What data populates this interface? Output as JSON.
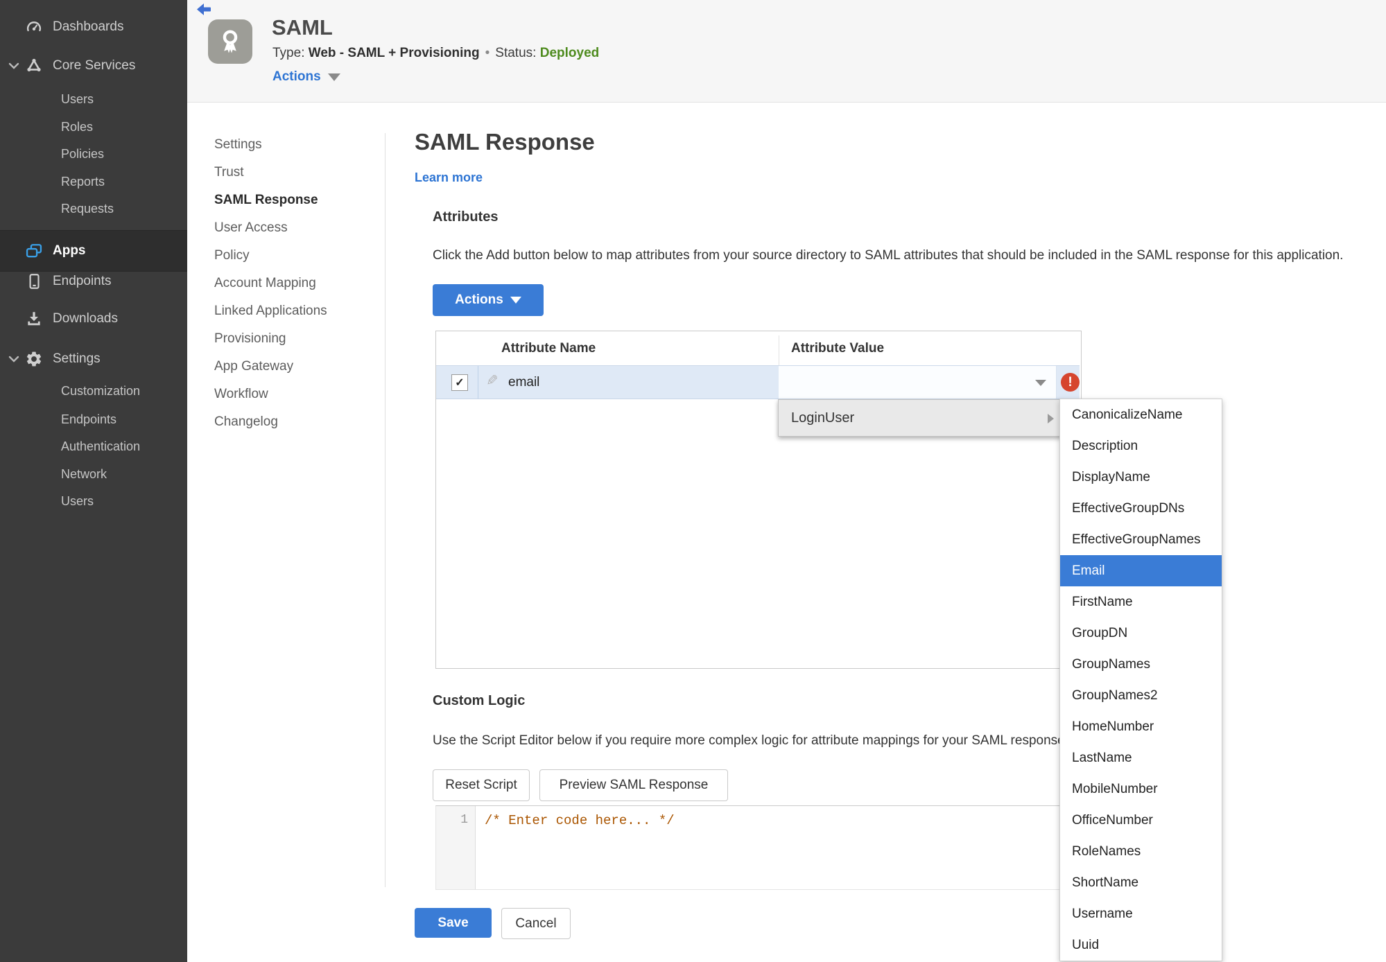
{
  "sidebar": {
    "items": [
      {
        "label": "Dashboards"
      },
      {
        "label": "Core Services"
      },
      {
        "label": "Apps"
      },
      {
        "label": "Endpoints"
      },
      {
        "label": "Downloads"
      },
      {
        "label": "Settings"
      }
    ],
    "core_services_children": [
      "Users",
      "Roles",
      "Policies",
      "Reports",
      "Requests"
    ],
    "settings_children": [
      "Customization",
      "Endpoints",
      "Authentication",
      "Network",
      "Users"
    ]
  },
  "header": {
    "title": "SAML",
    "type_label": "Type:",
    "type_value": "Web - SAML + Provisioning",
    "separator": "•",
    "status_label": "Status:",
    "status_value": "Deployed",
    "actions_label": "Actions"
  },
  "subnav": {
    "items": [
      "Settings",
      "Trust",
      "SAML Response",
      "User Access",
      "Policy",
      "Account Mapping",
      "Linked Applications",
      "Provisioning",
      "App Gateway",
      "Workflow",
      "Changelog"
    ],
    "active": "SAML Response"
  },
  "main": {
    "page_title": "SAML Response",
    "learn_more": "Learn more",
    "attributes": {
      "heading": "Attributes",
      "description": "Click the Add button below to map attributes from your source directory to SAML attributes that should be included in the SAML response for this application.",
      "actions_button": "Actions"
    },
    "table": {
      "columns": [
        "Attribute Name",
        "Attribute Value"
      ],
      "rows": [
        {
          "checked": "✓",
          "name": "email",
          "value": ""
        }
      ]
    },
    "custom_logic": {
      "heading": "Custom Logic",
      "description": "Use the Script Editor below if you require more complex logic for attribute mappings for your SAML response.",
      "reset_button": "Reset Script",
      "preview_button": "Preview SAML Response",
      "editor": {
        "line_number": "1",
        "code": "/* Enter code here... */"
      }
    },
    "save_button": "Save",
    "cancel_button": "Cancel"
  },
  "value_menu": {
    "parent": "LoginUser",
    "items": [
      "CanonicalizeName",
      "Description",
      "DisplayName",
      "EffectiveGroupDNs",
      "EffectiveGroupNames",
      "Email",
      "FirstName",
      "GroupDN",
      "GroupNames",
      "GroupNames2",
      "HomeNumber",
      "LastName",
      "MobileNumber",
      "OfficeNumber",
      "RoleNames",
      "ShortName",
      "Username",
      "Uuid"
    ],
    "selected": "Email"
  },
  "colors": {
    "accent_blue": "#3a7cd6",
    "status_green": "#4e8b1e",
    "error_red": "#d6452e",
    "sidebar_bg": "#3b3b3b",
    "app_icon_blue": "#3aa0e8",
    "row_highlight": "#dfe9f6"
  }
}
